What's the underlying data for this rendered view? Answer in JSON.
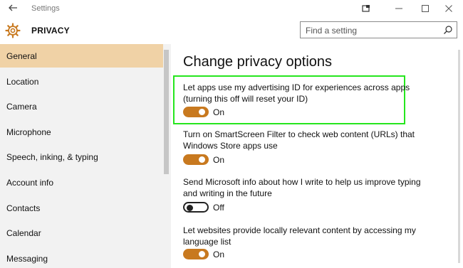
{
  "window": {
    "title": "Settings"
  },
  "header": {
    "title": "PRIVACY",
    "search_placeholder": "Find a setting"
  },
  "sidebar": {
    "items": [
      {
        "label": "General",
        "active": true
      },
      {
        "label": "Location"
      },
      {
        "label": "Camera"
      },
      {
        "label": "Microphone"
      },
      {
        "label": "Speech, inking, & typing"
      },
      {
        "label": "Account info"
      },
      {
        "label": "Contacts"
      },
      {
        "label": "Calendar"
      },
      {
        "label": "Messaging"
      }
    ]
  },
  "main": {
    "title": "Change privacy options",
    "options": [
      {
        "text_line1": "Let apps use my advertising ID for experiences across apps",
        "text_line2": "(turning this off will reset your ID)",
        "state": "On"
      },
      {
        "text_line1": "Turn on SmartScreen Filter to check web content (URLs) that",
        "text_line2": "Windows Store apps use",
        "state": "On"
      },
      {
        "text_line1": "Send Microsoft info about how I write to help us improve typing",
        "text_line2": "and writing in the future",
        "state": "Off"
      },
      {
        "text_line1": "Let websites provide locally relevant content by accessing my",
        "text_line2": "language list",
        "state": "On"
      }
    ]
  },
  "colors": {
    "accent": "#c8791f",
    "active_nav": "#f0d2a6",
    "highlight": "#26e61e"
  }
}
